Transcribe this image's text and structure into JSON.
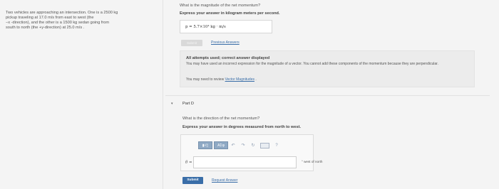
{
  "problem": {
    "lines": [
      "Two vehicles are approaching an intersection. One is a 2500 kg",
      "pickup traveling at 17.0 m/s from east to west (the",
      "−x -direction), and the other is a 1500 kg sedan going from",
      "south to north (the +y-direction) at 25.0 m/s ."
    ]
  },
  "part_c": {
    "question": "What is the magnitude of the net momentum?",
    "instruction": "Express your answer in kilogram meters per second.",
    "answer": "p =  5.7×10⁴  kg · m/s",
    "submit_label": "Submit",
    "previous_answers_label": "Previous Answers"
  },
  "feedback": {
    "title": "All attempts used; correct answer displayed",
    "body": "You may have used an incorrect expression for the magnitude of a vector. You cannot add these components of the momentum because they are perpendicular.",
    "review_prefix": "You may need to review ",
    "review_link": "Vector Magnitudes",
    "review_suffix": " ."
  },
  "part_d": {
    "toggle": "▾",
    "title": "Part D",
    "question": "What is the direction of the net momentum?",
    "instruction": "Express your answer in degrees measured from north to west.",
    "toolbar": {
      "template_label": "▮√▯",
      "greek_label": "ΑΣφ",
      "undo_icon": "↶",
      "redo_icon": "↷",
      "reset_icon": "↻",
      "help_label": "?"
    },
    "variable": "θ =",
    "input_value": "",
    "unit": "° west of north",
    "submit_label": "Submit",
    "request_label": "Request Answer"
  }
}
